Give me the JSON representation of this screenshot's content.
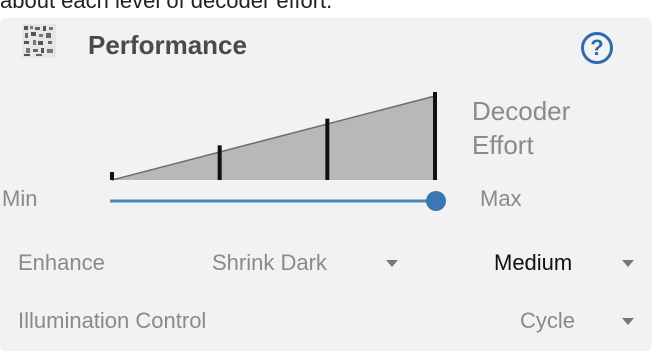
{
  "intro_text": "about each level of decoder effort.",
  "panel": {
    "title": "Performance",
    "help_glyph": "?",
    "icons": {
      "header": "barcode-scan-icon",
      "help": "question-circle-icon"
    }
  },
  "effort": {
    "title_line1": "Decoder",
    "title_line2": "Effort",
    "min_label": "Min",
    "max_label": "Max",
    "levels": 4,
    "selected_level": 4,
    "slider_fraction": 1.0
  },
  "enhance": {
    "label": "Enhance",
    "option": "Shrink Dark",
    "level": "Medium"
  },
  "illumination": {
    "label": "Illumination Control",
    "value": "Cycle"
  },
  "colors": {
    "slider_track": "#4a86b8",
    "slider_thumb": "#3b78b3",
    "wedge_fill": "#b8b8b8",
    "bars": "#111111",
    "panel_bg": "#f2f2f2",
    "accent": "#2b6cb0"
  }
}
